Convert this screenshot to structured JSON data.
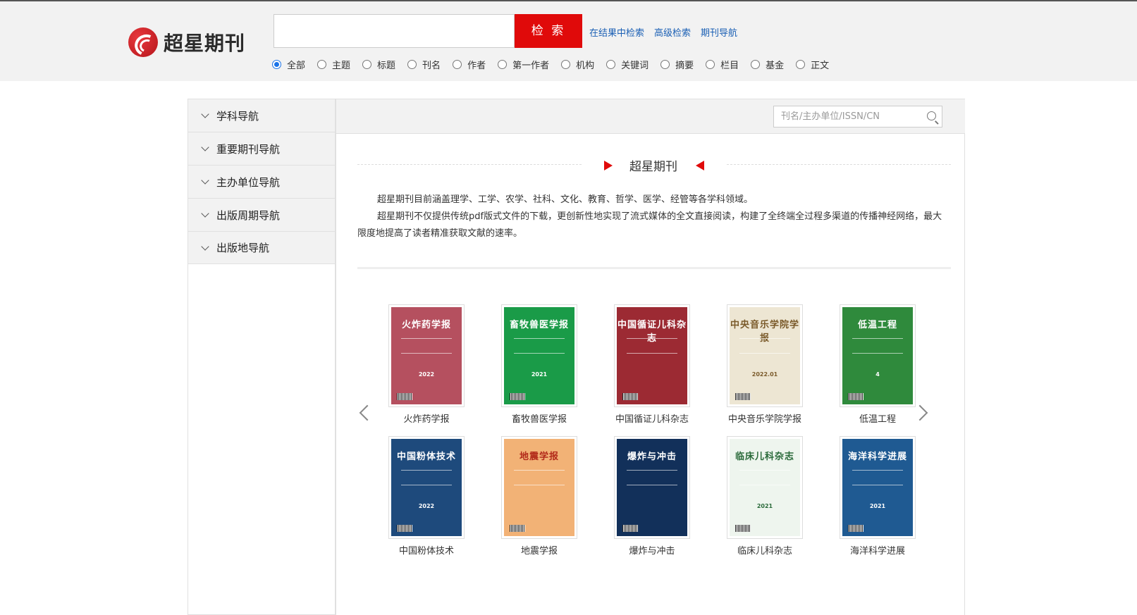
{
  "header": {
    "logo_text": "超星期刊",
    "search_value": "",
    "search_button": "检 索",
    "links": [
      "在结果中检索",
      "高级检索",
      "期刊导航"
    ],
    "filters": [
      {
        "label": "全部",
        "checked": true
      },
      {
        "label": "主题",
        "checked": false
      },
      {
        "label": "标题",
        "checked": false
      },
      {
        "label": "刊名",
        "checked": false
      },
      {
        "label": "作者",
        "checked": false
      },
      {
        "label": "第一作者",
        "checked": false
      },
      {
        "label": "机构",
        "checked": false
      },
      {
        "label": "关键词",
        "checked": false
      },
      {
        "label": "摘要",
        "checked": false
      },
      {
        "label": "栏目",
        "checked": false
      },
      {
        "label": "基金",
        "checked": false
      },
      {
        "label": "正文",
        "checked": false
      }
    ]
  },
  "sidebar": {
    "items": [
      "学科导航",
      "重要期刊导航",
      "主办单位导航",
      "出版周期导航",
      "出版地导航"
    ]
  },
  "main": {
    "filter_placeholder": "刊名/主办单位/ISSN/CN",
    "section_title": "超星期刊",
    "intro_1": "超星期刊目前涵盖理学、工学、农学、社科、文化、教育、哲学、医学、经管等各学科领域。",
    "intro_2": "超星期刊不仅提供传统pdf版式文件的下载，更创新性地实现了流式媒体的全文直接阅读，构建了全终端全过程多渠道的传播神经网络，最大限度地提高了读者精准获取文献的速率。",
    "journals": [
      {
        "name": "火炸药学报",
        "cover_title": "火炸药学报",
        "year": "2022",
        "bg": "#b5505f",
        "fg": "#ffffff"
      },
      {
        "name": "畜牧兽医学报",
        "cover_title": "畜牧兽医学报",
        "year": "2021",
        "bg": "#1a9b48",
        "fg": "#ffffff"
      },
      {
        "name": "中国循证儿科杂志",
        "cover_title": "中国循证儿科杂志",
        "year": "",
        "bg": "#9c2a33",
        "fg": "#ffffff"
      },
      {
        "name": "中央音乐学院学报",
        "cover_title": "中央音乐学院学报",
        "year": "2022.01",
        "bg": "#ede6d3",
        "fg": "#7a5a2a"
      },
      {
        "name": "低温工程",
        "cover_title": "低温工程",
        "year": "4",
        "bg": "#2f8a3c",
        "fg": "#ffffff"
      },
      {
        "name": "中国粉体技术",
        "cover_title": "中国粉体技术",
        "year": "2022",
        "bg": "#1e4a7c",
        "fg": "#ffffff"
      },
      {
        "name": "地震学报",
        "cover_title": "地震学报",
        "year": "",
        "bg": "#f2b276",
        "fg": "#b22a1a"
      },
      {
        "name": "爆炸与冲击",
        "cover_title": "爆炸与冲击",
        "year": "",
        "bg": "#12305a",
        "fg": "#ffffff"
      },
      {
        "name": "临床儿科杂志",
        "cover_title": "临床儿科杂志",
        "year": "2021",
        "bg": "#eef5ee",
        "fg": "#2a6a3a"
      },
      {
        "name": "海洋科学进展",
        "cover_title": "海洋科学进展",
        "year": "2021",
        "bg": "#1f5a92",
        "fg": "#ffffff"
      }
    ]
  }
}
